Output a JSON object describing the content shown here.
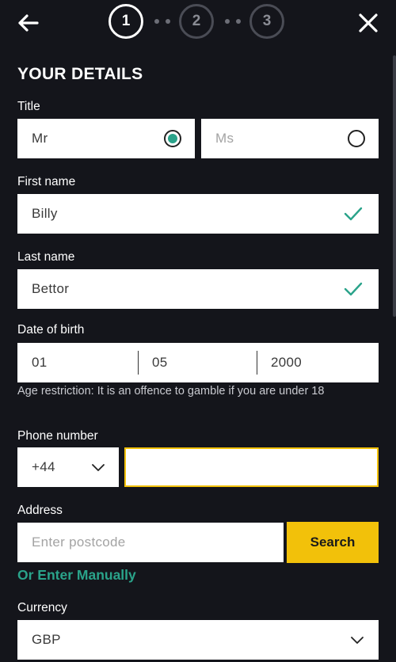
{
  "header": {
    "steps": [
      "1",
      "2",
      "3"
    ],
    "active_step": 1
  },
  "form": {
    "title": "YOUR DETAILS",
    "title_field": {
      "label": "Title",
      "options": [
        "Mr",
        "Ms"
      ],
      "selected": "Mr"
    },
    "first_name": {
      "label": "First name",
      "value": "Billy"
    },
    "last_name": {
      "label": "Last name",
      "value": "Bettor"
    },
    "dob": {
      "label": "Date of birth",
      "day": "01",
      "month": "05",
      "year": "2000",
      "hint": "Age restriction: It is an offence to gamble if you are under 18"
    },
    "phone": {
      "label": "Phone number",
      "country_code": "+44",
      "value": ""
    },
    "address": {
      "label": "Address",
      "placeholder": "Enter postcode",
      "search_label": "Search",
      "manual_link": "Or Enter Manually"
    },
    "currency": {
      "label": "Currency",
      "value": "GBP"
    }
  },
  "colors": {
    "background": "#14151b",
    "accent_green": "#2aa38a",
    "button_yellow": "#f2c10a",
    "focus_border": "#f2c10a"
  }
}
